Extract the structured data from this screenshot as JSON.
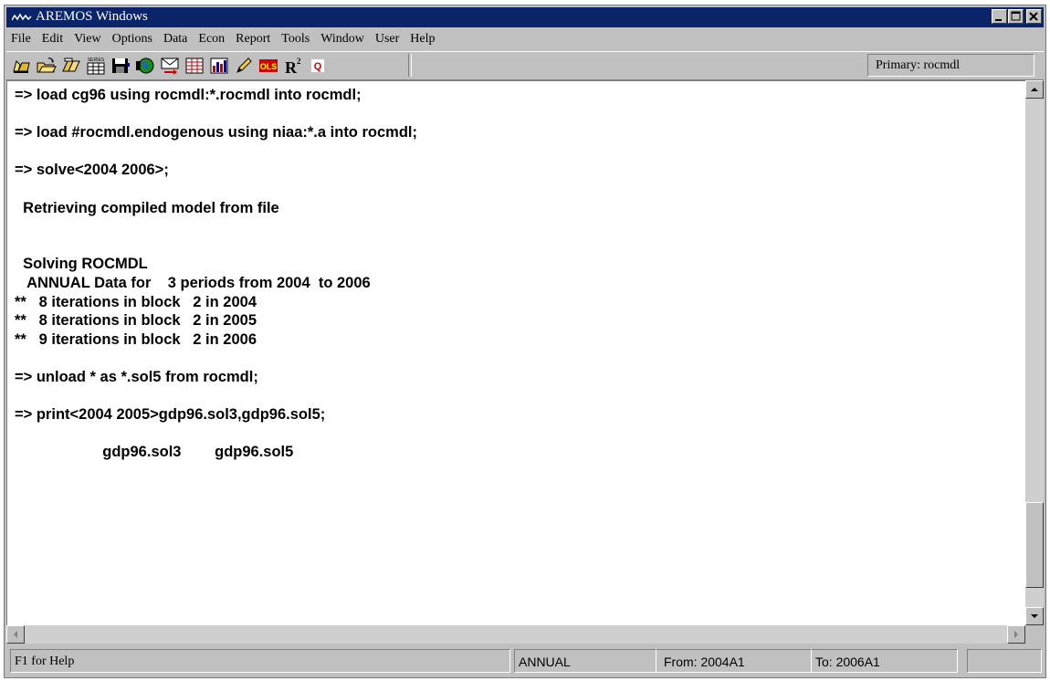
{
  "window": {
    "title": "AREMOS Windows"
  },
  "menu": [
    "File",
    "Edit",
    "View",
    "Options",
    "Data",
    "Econ",
    "Report",
    "Tools",
    "Window",
    "User",
    "Help"
  ],
  "toolbar": {
    "icons": [
      "open-folder-icon",
      "open-file-icon",
      "open-database-icon",
      "series-icon",
      "save-icon",
      "globe-icon",
      "mail-icon",
      "table-icon",
      "chart-icon",
      "edit-pencil-icon",
      "ols-icon",
      "r-squared-icon",
      "q-icon"
    ],
    "ols_label": "OLS",
    "r2_label": "R",
    "r2_sup": "2",
    "q_label": "Q",
    "series_label": "SERIES",
    "primary": "Primary: rocmdl"
  },
  "console": {
    "lines": [
      "=> load cg96 using rocmdl:*.rocmdl into rocmdl;",
      "",
      "=> load #rocmdl.endogenous using niaa:*.a into rocmdl;",
      "",
      "=> solve<2004 2006>;",
      "",
      "  Retrieving compiled model from file",
      "",
      "",
      "  Solving ROCMDL",
      "   ANNUAL Data for    3 periods from 2004  to 2006",
      "**   8 iterations in block   2 in 2004",
      "**   8 iterations in block   2 in 2005",
      "**   9 iterations in block   2 in 2006",
      "",
      "=> unload * as *.sol5 from rocmdl;",
      "",
      "=> print<2004 2005>gdp96.sol3,gdp96.sol5;",
      "",
      "                     gdp96.sol3        gdp96.sol5"
    ]
  },
  "statusbar": {
    "help": "F1 for Help",
    "frequency": "ANNUAL",
    "from": "From:  2004A1",
    "to": "To:  2006A1"
  },
  "colors": {
    "titlebar": "#0a246a",
    "chrome": "#c0c0c0",
    "content_bg": "#ffffff"
  }
}
